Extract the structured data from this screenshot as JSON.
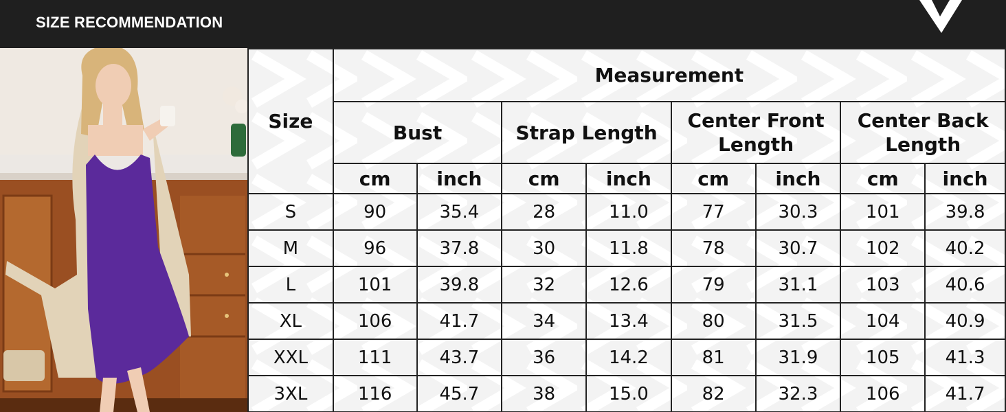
{
  "header": {
    "title": "SIZE RECOMMENDATION"
  },
  "colors": {
    "bar": "#1f1f1f",
    "dress": "#5b2a9b",
    "table_bg": "#f3f3f3",
    "grid": "#222222"
  },
  "table": {
    "size_header": "Size",
    "group_header": "Measurement",
    "columns": [
      {
        "label": "Bust"
      },
      {
        "label": "Strap Length"
      },
      {
        "label": "Center Front Length"
      },
      {
        "label": "Center Back Length"
      }
    ],
    "units": [
      "cm",
      "inch",
      "cm",
      "inch",
      "cm",
      "inch",
      "cm",
      "inch"
    ],
    "rows": [
      {
        "size": "S",
        "values": [
          "90",
          "35.4",
          "28",
          "11.0",
          "77",
          "30.3",
          "101",
          "39.8"
        ]
      },
      {
        "size": "M",
        "values": [
          "96",
          "37.8",
          "30",
          "11.8",
          "78",
          "30.7",
          "102",
          "40.2"
        ]
      },
      {
        "size": "L",
        "values": [
          "101",
          "39.8",
          "32",
          "12.6",
          "79",
          "31.1",
          "103",
          "40.6"
        ]
      },
      {
        "size": "XL",
        "values": [
          "106",
          "41.7",
          "34",
          "13.4",
          "80",
          "31.5",
          "104",
          "40.9"
        ]
      },
      {
        "size": "XXL",
        "values": [
          "111",
          "43.7",
          "36",
          "14.2",
          "81",
          "31.9",
          "105",
          "41.3"
        ]
      },
      {
        "size": "3XL",
        "values": [
          "116",
          "45.7",
          "38",
          "15.0",
          "82",
          "32.3",
          "106",
          "41.7"
        ]
      }
    ]
  }
}
